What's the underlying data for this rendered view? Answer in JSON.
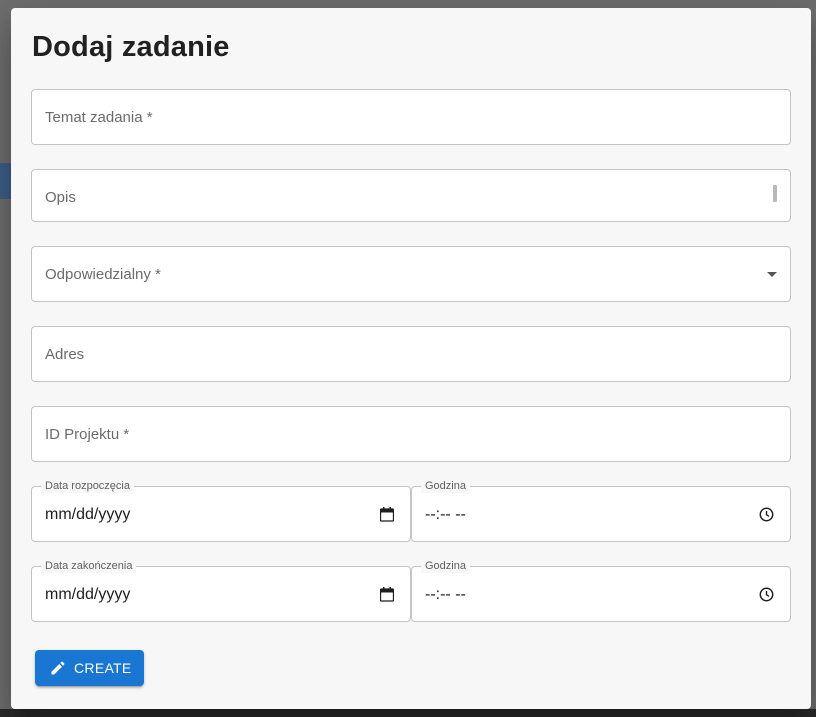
{
  "dialog": {
    "title": "Dodaj zadanie"
  },
  "form": {
    "topic": {
      "label": "Temat zadania *"
    },
    "description": {
      "label": "Opis"
    },
    "assignee": {
      "label": "Odpowiedzialny *"
    },
    "address": {
      "label": "Adres"
    },
    "project_id": {
      "label": "ID Projektu *"
    },
    "start_date": {
      "legend": "Data rozpoczęcia",
      "placeholder": "mm/dd/yyyy"
    },
    "start_time": {
      "legend": "Godzina",
      "placeholder": "--:-- --"
    },
    "end_date": {
      "legend": "Data zakończenia",
      "placeholder": "mm/dd/yyyy"
    },
    "end_time": {
      "legend": "Godzina",
      "placeholder": "--:-- --"
    }
  },
  "actions": {
    "create_label": "CREATE",
    "create_icon": "pencil-icon"
  },
  "colors": {
    "primary": "#1976d2",
    "dialog_bg": "#f7f7f7",
    "border": "#c4c4c4"
  },
  "icons": {
    "date_picker": "calendar-icon",
    "time_picker": "clock-icon",
    "select": "arrow-drop-down-icon"
  }
}
